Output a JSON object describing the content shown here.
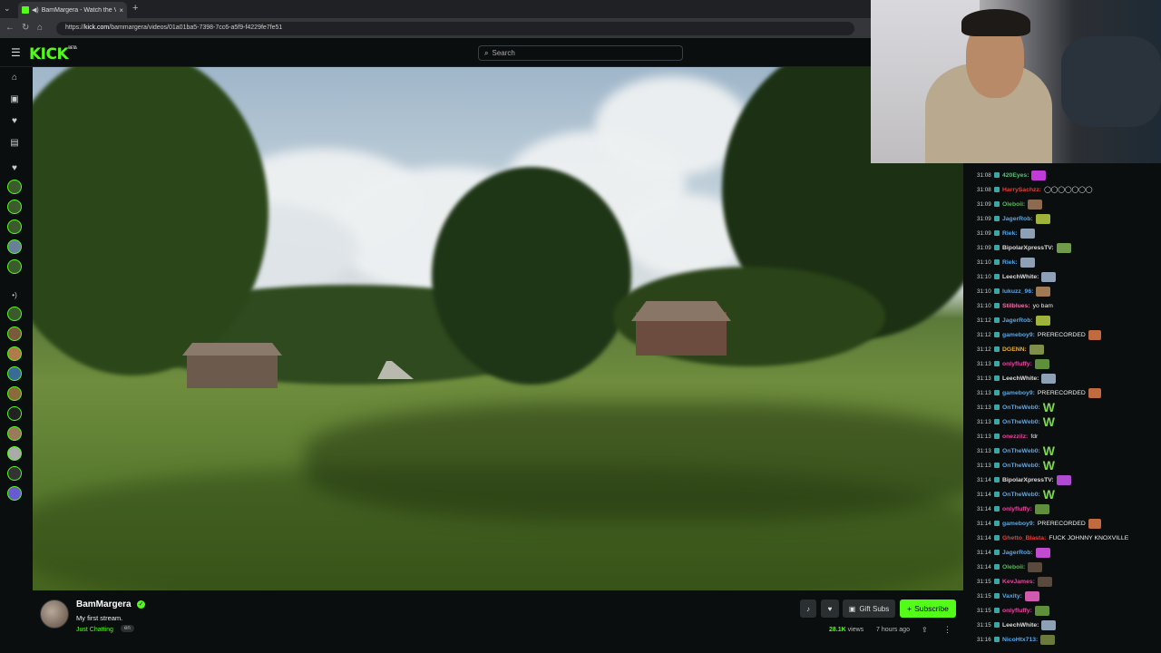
{
  "browser": {
    "tab_title": "BamMargera - Watch the VOD",
    "tab_close": "×",
    "new_tab": "+",
    "url_prefix": "https://",
    "url_host": "kick.com",
    "url_path": "/bammargera/videos/01a01ba5-7398-7cc6-a5f9-f4229fe7fe51",
    "nav": {
      "back": "←",
      "forward": "→",
      "reload": "↻",
      "home": "⌂"
    }
  },
  "header": {
    "logo": "KICK",
    "logo_beta": "BETA",
    "search_placeholder": "Search"
  },
  "stream": {
    "streamer": "BamMargera",
    "title": "My first stream.",
    "category": "Just Chatting",
    "language": "en",
    "views": "28.1K",
    "views_label": "views",
    "time_ago": "7 hours ago",
    "gift_label": "Gift Subs",
    "subscribe_label": "Subscribe"
  },
  "chat": {
    "messages": [
      {
        "time": "31:08",
        "user": "420Eyes:",
        "color": "#3fd06b",
        "text": "",
        "emote": "#c13bd9"
      },
      {
        "time": "31:08",
        "user": "HarrySachzz:",
        "color": "#e0403c",
        "text": "◯◯◯◯◯◯◯",
        "emote": ""
      },
      {
        "time": "31:09",
        "user": "Oleboii:",
        "color": "#4fbf4f",
        "text": "",
        "emote": "#8b6a4f"
      },
      {
        "time": "31:09",
        "user": "JagerRob:",
        "color": "#56a7e8",
        "text": "",
        "emote": "#9fb23a"
      },
      {
        "time": "31:09",
        "user": "Riek:",
        "color": "#56a7e8",
        "text": "",
        "emote": "#8da0b6"
      },
      {
        "time": "31:09",
        "user": "BipolarXpressTV:",
        "color": "#dddddd",
        "text": "",
        "emote": "#6f9b4a"
      },
      {
        "time": "31:10",
        "user": "Riek:",
        "color": "#56a7e8",
        "text": "",
        "emote": "#8da0b6"
      },
      {
        "time": "31:10",
        "user": "LeechWhite:",
        "color": "#dddddd",
        "text": "",
        "emote": "#8da0b6"
      },
      {
        "time": "31:10",
        "user": "lukuzz_96:",
        "color": "#56a7e8",
        "text": "",
        "emote": "#a07a55"
      },
      {
        "time": "31:10",
        "user": "Stilblues:",
        "color": "#e07ba6",
        "text": "yo bam",
        "emote": ""
      },
      {
        "time": "31:12",
        "user": "JagerRob:",
        "color": "#56a7e8",
        "text": "",
        "emote": "#9fb23a"
      },
      {
        "time": "31:12",
        "user": "gameboy9:",
        "color": "#56a7e8",
        "text": "PRERECORDED",
        "emote": "#c06a3f"
      },
      {
        "time": "31:12",
        "user": "DGENN:",
        "color": "#e8b030",
        "text": "",
        "emote": "#7f8f4a"
      },
      {
        "time": "31:13",
        "user": "onlyfluffy:",
        "color": "#e04a9c",
        "text": "",
        "emote": "#5f8f3a"
      },
      {
        "time": "31:13",
        "user": "LeechWhite:",
        "color": "#dddddd",
        "text": "",
        "emote": "#8da0b6"
      },
      {
        "time": "31:13",
        "user": "gameboy9:",
        "color": "#56a7e8",
        "text": "PRERECORDED",
        "emote": "#c06a3f"
      },
      {
        "time": "31:13",
        "user": "OnTheWeb0:",
        "color": "#56a7e8",
        "text": "W",
        "emote": ""
      },
      {
        "time": "31:13",
        "user": "OnTheWeb0:",
        "color": "#56a7e8",
        "text": "W",
        "emote": ""
      },
      {
        "time": "31:13",
        "user": "onezzilz:",
        "color": "#e04a9c",
        "text": "fdr",
        "emote": ""
      },
      {
        "time": "31:13",
        "user": "OnTheWeb0:",
        "color": "#56a7e8",
        "text": "W",
        "emote": ""
      },
      {
        "time": "31:13",
        "user": "OnTheWeb0:",
        "color": "#56a7e8",
        "text": "W",
        "emote": ""
      },
      {
        "time": "31:14",
        "user": "BipolarXpressTV:",
        "color": "#dddddd",
        "text": "",
        "emote": "#b04ad0"
      },
      {
        "time": "31:14",
        "user": "OnTheWeb0:",
        "color": "#56a7e8",
        "text": "W",
        "emote": ""
      },
      {
        "time": "31:14",
        "user": "onlyfluffy:",
        "color": "#e04a9c",
        "text": "",
        "emote": "#5f8f3a"
      },
      {
        "time": "31:14",
        "user": "gameboy9:",
        "color": "#56a7e8",
        "text": "PRERECORDED",
        "emote": "#c06a3f"
      },
      {
        "time": "31:14",
        "user": "Ghetto_Blasta:",
        "color": "#e0403c",
        "text": "FUCK JOHNNY KNOXVILLE",
        "emote": ""
      },
      {
        "time": "31:14",
        "user": "JagerRob:",
        "color": "#56a7e8",
        "text": "",
        "emote": "#c04ad0"
      },
      {
        "time": "31:14",
        "user": "Oleboii:",
        "color": "#4fbf4f",
        "text": "",
        "emote": "#5a4a3e"
      },
      {
        "time": "31:15",
        "user": "KevJames:",
        "color": "#e04a9c",
        "text": "",
        "emote": "#5a4a3e"
      },
      {
        "time": "31:15",
        "user": "Vaxity:",
        "color": "#56a7e8",
        "text": "",
        "emote": "#d05ab0"
      },
      {
        "time": "31:15",
        "user": "onlyfluffy:",
        "color": "#e04a9c",
        "text": "",
        "emote": "#5f8f3a"
      },
      {
        "time": "31:15",
        "user": "LeechWhite:",
        "color": "#dddddd",
        "text": "",
        "emote": "#8da0b6"
      },
      {
        "time": "31:16",
        "user": "NicoHtx713:",
        "color": "#56a7e8",
        "text": "",
        "emote": "#6a7a3a"
      }
    ]
  },
  "colors": {
    "accent": "#53fc18",
    "background": "#0b0e0f"
  },
  "icons": [
    "menu-icon",
    "search-icon",
    "home-icon",
    "browse-icon",
    "following-icon",
    "clips-icon",
    "heart-icon",
    "recommended-icon",
    "verified-icon",
    "bell-icon",
    "gift-icon",
    "plus-icon",
    "share-icon",
    "more-icon"
  ]
}
